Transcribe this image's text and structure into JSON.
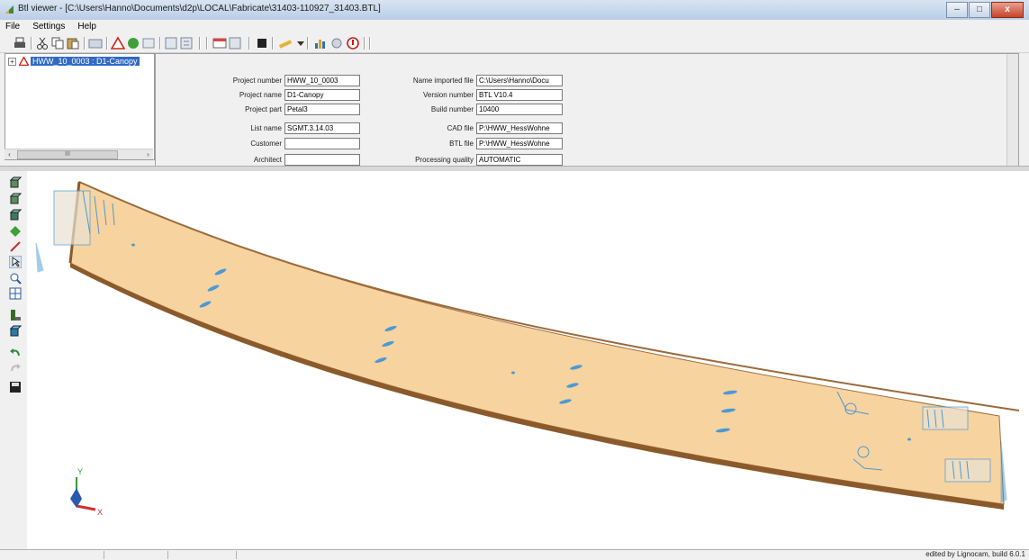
{
  "window": {
    "title": "Btl viewer - [C:\\Users\\Hanno\\Documents\\d2p\\LOCAL\\Fabricate\\31403-110927_31403.BTL]",
    "minimize": "–",
    "maximize": "□",
    "close": "x"
  },
  "menu": [
    "File",
    "Settings",
    "Help"
  ],
  "tree": {
    "expander": "+",
    "root_label": "HWW_10_0003 : D1-Canopy"
  },
  "tree_scroll": {
    "thumb": "III",
    "left": "‹",
    "right": "›"
  },
  "properties": {
    "left": [
      {
        "label": "Project number",
        "value": "HWW_10_0003"
      },
      {
        "label": "Project name",
        "value": "D1-Canopy"
      },
      {
        "label": "Project part",
        "value": "Petal3"
      },
      {
        "label": "List name",
        "value": "SGMT.3.14.03"
      },
      {
        "label": "Customer",
        "value": ""
      },
      {
        "label": "Architect",
        "value": ""
      }
    ],
    "right": [
      {
        "label": "Name imported file",
        "value": "C:\\Users\\Hanno\\Docu"
      },
      {
        "label": "Version number",
        "value": "BTL V10.4"
      },
      {
        "label": "Build number",
        "value": "10400"
      },
      {
        "label": "CAD file",
        "value": "P:\\HWW_HessWohne"
      },
      {
        "label": "BTL file",
        "value": "P:\\HWW_HessWohne"
      },
      {
        "label": "Processing quality",
        "value": "AUTOMATIC"
      }
    ]
  },
  "toolbar_icons": [
    "print-icon",
    "cut-icon",
    "copy-icon",
    "paste-icon",
    "open-icon",
    "warning-icon",
    "ok-icon",
    "preview-icon",
    "list-icon",
    "export-icon",
    "table-icon",
    "report-icon",
    "color-icon",
    "pen-icon",
    "chart-icon",
    "settings-icon",
    "help-icon"
  ],
  "left_toolbar_icons": [
    "view-iso1-icon",
    "view-iso2-icon",
    "view-iso3-icon",
    "shade-icon",
    "pen-icon",
    "select-icon",
    "zoom-icon",
    "fit-icon",
    "part-icon",
    "box-icon",
    "undo-icon",
    "redo-icon",
    "save-icon"
  ],
  "axis": {
    "x_label": "X",
    "y_label": "Y"
  },
  "colors": {
    "beam_fill": "#f7d3a0",
    "beam_edge": "#8b5a2b",
    "marker": "#4a9ad4"
  },
  "status": {
    "text": "edited by Lignocam, build 6.0.1"
  }
}
